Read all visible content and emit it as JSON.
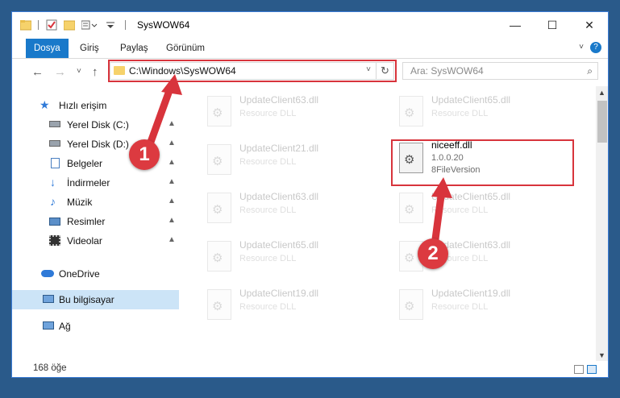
{
  "window": {
    "title": "SysWOW64",
    "minimize_glyph": "—",
    "maximize_glyph": "☐",
    "close_glyph": "✕"
  },
  "ribbon": {
    "tabs": [
      "Dosya",
      "Giriş",
      "Paylaş",
      "Görünüm"
    ],
    "active_tab": "Dosya",
    "help_glyph": "?",
    "collapse_glyph": "˅"
  },
  "address": {
    "path": "C:\\Windows\\SysWOW64",
    "dropdown_glyph": "˅",
    "refresh_glyph": "↻"
  },
  "search": {
    "placeholder": "Ara: SysWOW64",
    "icon_glyph": "⌕"
  },
  "nav_buttons": {
    "back": "←",
    "forward": "→",
    "recent": "˅",
    "up": "↑"
  },
  "navpane": {
    "items": [
      {
        "label": "Hızlı erişim",
        "icon": "star-icon",
        "pinned": false
      },
      {
        "label": "Yerel Disk (C:)",
        "icon": "drive-icon",
        "pinned": true
      },
      {
        "label": "Yerel Disk (D:)",
        "icon": "drive-icon",
        "pinned": true
      },
      {
        "label": "Belgeler",
        "icon": "documents-icon",
        "pinned": true
      },
      {
        "label": "İndirmeler",
        "icon": "download-icon",
        "pinned": true
      },
      {
        "label": "Müzik",
        "icon": "music-icon",
        "pinned": true
      },
      {
        "label": "Resimler",
        "icon": "pictures-icon",
        "pinned": true
      },
      {
        "label": "Videolar",
        "icon": "video-icon",
        "pinned": true
      },
      {
        "label": "OneDrive",
        "icon": "cloud-icon",
        "pinned": false
      },
      {
        "label": "Bu bilgisayar",
        "icon": "computer-icon",
        "pinned": false,
        "selected": true
      },
      {
        "label": "Ağ",
        "icon": "network-icon",
        "pinned": false
      }
    ],
    "pin_glyph": "📌"
  },
  "files": {
    "items": [
      {
        "name": "UpdateClient63.dll",
        "type": "Resource DLL",
        "faded": true
      },
      {
        "name": "UpdateClient65.dll",
        "type": "Resource DLL",
        "faded": true
      },
      {
        "name": "UpdateClient21.dll",
        "type": "Resource DLL",
        "faded": true
      },
      {
        "name": "niceeff.dll",
        "version": "1.0.0.20",
        "description": "8FileVersion",
        "faded": false,
        "highlighted": true
      },
      {
        "name": "UpdateClient63.dll",
        "type": "Resource DLL",
        "faded": true
      },
      {
        "name": "UpdateClient65.dll",
        "type": "Resource DLL",
        "faded": true
      },
      {
        "name": "UpdateClient65.dll",
        "type": "Resource DLL",
        "faded": true
      },
      {
        "name": "UpdateClient63.dll",
        "type": "Resource DLL",
        "faded": true
      },
      {
        "name": "UpdateClient19.dll",
        "type": "Resource DLL",
        "faded": true
      },
      {
        "name": "UpdateClient19.dll",
        "type": "Resource DLL",
        "faded": true
      }
    ]
  },
  "status": {
    "item_count": "168 öğe"
  },
  "annotations": {
    "step1": "1",
    "step2": "2",
    "color": "#d8343c"
  },
  "colors": {
    "accent": "#1979ca",
    "selection": "#cce4f7",
    "highlight": "#d8343c"
  }
}
